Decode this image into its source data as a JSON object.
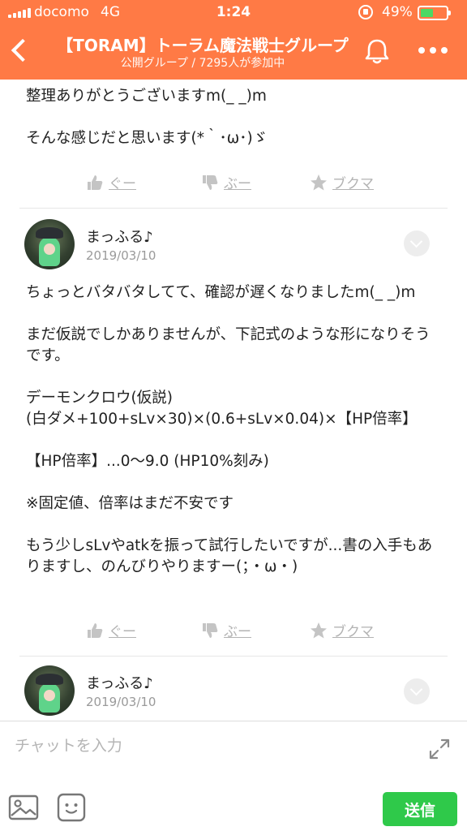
{
  "status_bar": {
    "carrier": "docomo",
    "network": "4G",
    "time": "1:24",
    "battery_percent": "49%",
    "battery_level": 0.49,
    "battery_color": "#4cd964"
  },
  "header": {
    "title": "【TORAM】トーラム魔法戦士グループ",
    "subtitle": "公開グループ / 7295人が参加中",
    "background_color": "#ff7a45",
    "icons": [
      "back-icon",
      "bell-icon",
      "more-icon"
    ]
  },
  "posts": [
    {
      "body": "整理ありがとうございますm(_ _)m\n\nそんな感じだと思います(*｀･ω･)ゞ",
      "actions": {
        "good": "ぐー",
        "boo": "ぶー",
        "bookmark": "ブクマ"
      }
    },
    {
      "author": "まっふる♪",
      "date": "2019/03/10",
      "body": "ちょっとバタバタしてて、確認が遅くなりましたm(_ _)m\n\nまだ仮説でしかありませんが、下記式のような形になりそうです。\n\nデーモンクロウ(仮説)\n(白ダメ+100+sLv×30)×(0.6+sLv×0.04)×【HP倍率】\n\n【HP倍率】...0〜9.0 (HP10%刻み)\n\n※固定値、倍率はまだ不安です\n\nもう少しsLvやatkを振って試行したいですが...書の入手もありますし、のんびりやりますー(；・ω・)",
      "actions": {
        "good": "ぐー",
        "boo": "ぶー",
        "bookmark": "ブクマ"
      }
    },
    {
      "author": "まっふる♪",
      "date": "2019/03/10"
    }
  ],
  "input_bar": {
    "placeholder": "チャットを入力",
    "send_label": "送信",
    "send_color": "#2fc94a",
    "icons": [
      "expand-icon",
      "image-icon",
      "stamp-icon"
    ]
  }
}
